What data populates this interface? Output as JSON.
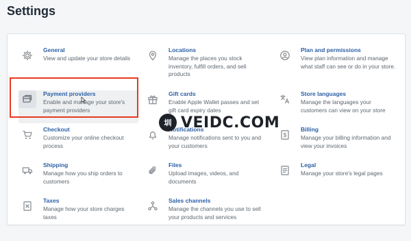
{
  "page": {
    "title": "Settings"
  },
  "settings": {
    "general": {
      "title": "General",
      "desc": "View and update your store details",
      "icon": "gear-icon"
    },
    "locations": {
      "title": "Locations",
      "desc": "Manage the places you stock inventory, fulfill orders, and sell products",
      "icon": "location-pin-icon"
    },
    "plan": {
      "title": "Plan and permissions",
      "desc": "View plan information and manage what staff can see or do in your store.",
      "icon": "user-circle-icon"
    },
    "payment": {
      "title": "Payment providers",
      "desc": "Enable and manage your store's payment providers",
      "icon": "credit-card-icon"
    },
    "giftcards": {
      "title": "Gift cards",
      "desc": "Enable Apple Wallet passes and set gift card expiry dates",
      "icon": "gift-icon"
    },
    "languages": {
      "title": "Store languages",
      "desc": "Manage the languages your customers can view on your store",
      "icon": "translate-icon"
    },
    "checkout": {
      "title": "Checkout",
      "desc": "Customize your online checkout process",
      "icon": "cart-icon"
    },
    "notifications": {
      "title": "Notifications",
      "desc": "Manage notifications sent to you and your customers",
      "icon": "bell-icon"
    },
    "billing": {
      "title": "Billing",
      "desc": "Manage your billing information and view your invoices",
      "icon": "dollar-doc-icon"
    },
    "shipping": {
      "title": "Shipping",
      "desc": "Manage how you ship orders to customers",
      "icon": "truck-icon"
    },
    "files": {
      "title": "Files",
      "desc": "Upload images, videos, and documents",
      "icon": "paperclip-icon"
    },
    "legal": {
      "title": "Legal",
      "desc": "Manage your store's legal pages",
      "icon": "legal-doc-icon"
    },
    "taxes": {
      "title": "Taxes",
      "desc": "Manage how your store charges taxes",
      "icon": "tax-doc-icon"
    },
    "channels": {
      "title": "Sales channels",
      "desc": "Manage the channels you use to sell your products and services",
      "icon": "share-nodes-icon"
    }
  },
  "watermark": {
    "logo": "VEIDC",
    "text": "VEIDC.COM"
  },
  "colors": {
    "link": "#2c5fa5",
    "highlight": "#e7391f",
    "background": "#f4f6f8"
  }
}
